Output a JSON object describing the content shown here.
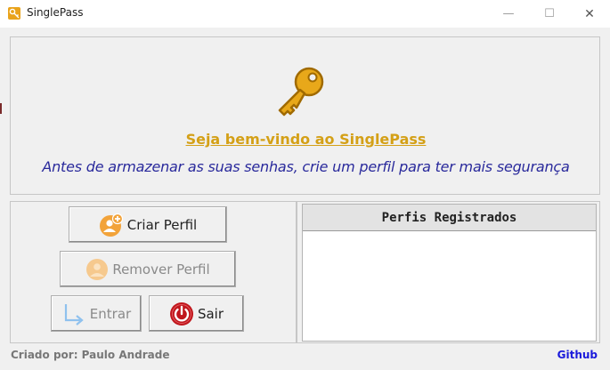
{
  "window": {
    "title": "SinglePass",
    "min_glyph": "—",
    "max_glyph": "☐",
    "close_glyph": "✕"
  },
  "header": {
    "welcome": "Seja bem-vindo ao SinglePass",
    "subtitle": "Antes de armazenar as suas senhas, crie um perfil para ter mais segurança"
  },
  "actions": {
    "criar": "Criar Perfil",
    "remover": "Remover Perfil",
    "entrar": "Entrar",
    "sair": "Sair"
  },
  "profiles": {
    "header": "Perfis Registrados",
    "items": []
  },
  "footer": {
    "credit": "Criado por: Paulo Andrade",
    "link": "Github"
  },
  "colors": {
    "accent_gold": "#d4a017",
    "subtitle_blue": "#2a2a9c",
    "link_blue": "#1a1adb",
    "exit_red": "#c0161c"
  }
}
